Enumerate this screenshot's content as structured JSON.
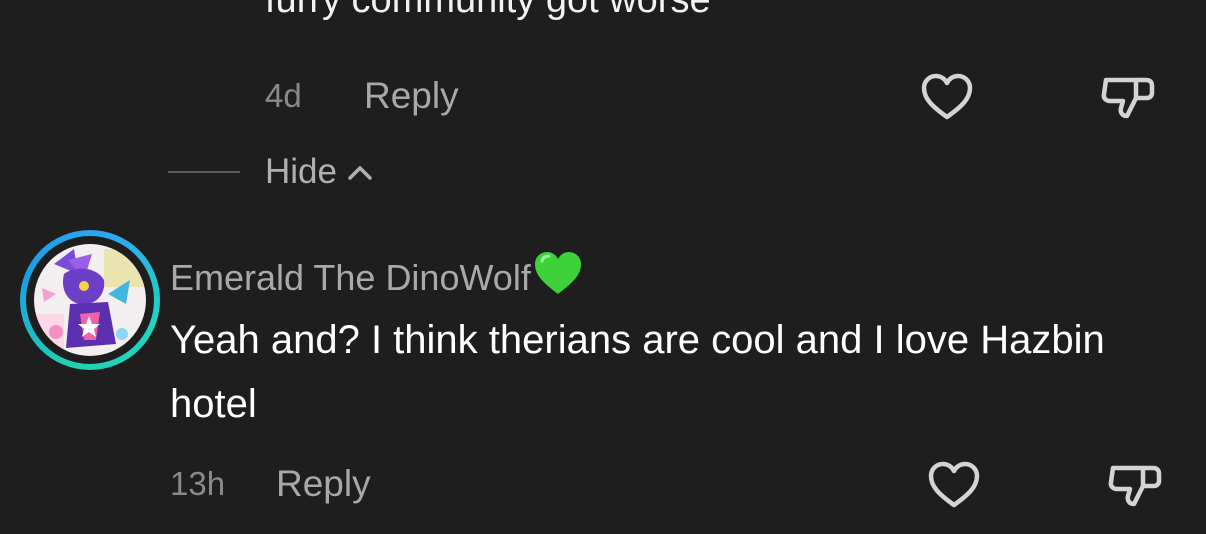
{
  "previous_comment": {
    "text_tail": "furry community got worse",
    "time": "4d",
    "reply_label": "Reply"
  },
  "replies_toggle": {
    "label": "Hide"
  },
  "comment": {
    "username": "Emerald The DinoWolf",
    "username_emoji": "green-heart",
    "text": "Yeah and? I think therians are cool and I love Hazbin hotel",
    "time": "13h",
    "reply_label": "Reply"
  },
  "colors": {
    "background": "#1e1e1e",
    "avatar_ring": "#22c4d0",
    "emoji_heart": "#3ed13a"
  }
}
